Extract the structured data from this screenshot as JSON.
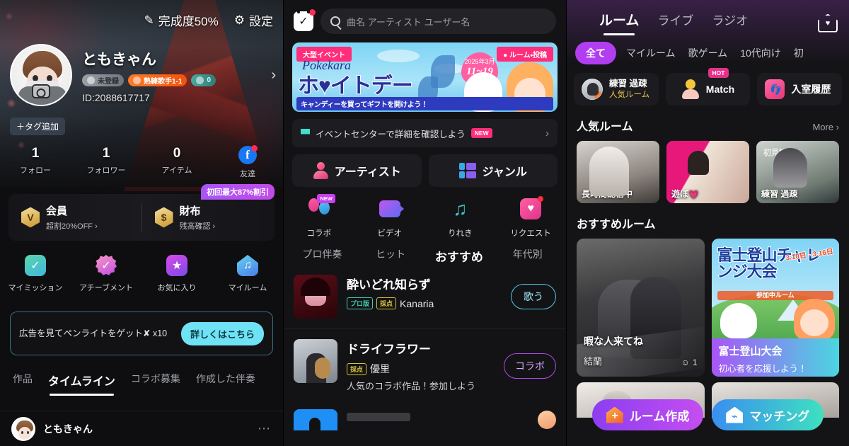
{
  "profile_panel": {
    "topbar": {
      "completion_label": "完成度50%",
      "completion_icon": "pencil-icon",
      "settings_label": "設定",
      "settings_icon": "gear-icon"
    },
    "user": {
      "name": "ともきゃん",
      "id_label": "ID:2088617717",
      "badges": [
        {
          "label": "未登録",
          "style": "gray"
        },
        {
          "label": "熟練歌手1-1",
          "style": "orange"
        },
        {
          "label": "0",
          "style": "teal"
        }
      ],
      "add_tag_label": "＋タグ追加",
      "chevron": "›"
    },
    "stats": [
      {
        "num": "1",
        "label": "フォロー"
      },
      {
        "num": "1",
        "label": "フォロワー"
      },
      {
        "num": "0",
        "label": "アイテム"
      },
      {
        "num": "f",
        "label": "友達"
      }
    ],
    "promo_badge": "初回最大87%割引",
    "cards": [
      {
        "icon": "V",
        "title": "会員",
        "sub": "超割20%OFF ›"
      },
      {
        "icon": "$",
        "title": "財布",
        "sub": "残高確認 ›"
      }
    ],
    "grid": [
      {
        "label": "マイミッション",
        "icon": "mission-icon"
      },
      {
        "label": "アチーブメント",
        "icon": "achievement-icon"
      },
      {
        "label": "お気に入り",
        "icon": "favorite-icon"
      },
      {
        "label": "マイルーム",
        "icon": "myroom-icon"
      }
    ],
    "ad": {
      "text": "広告を見てペンライトをゲット✘ x10",
      "button": "詳しくはこちら"
    },
    "tabs": [
      {
        "label": "作品",
        "active": false
      },
      {
        "label": "タイムライン",
        "active": true
      },
      {
        "label": "コラボ募集",
        "active": false
      },
      {
        "label": "作成した伴奏",
        "active": false
      }
    ],
    "feed": {
      "username": "ともきゃん",
      "more": "⋯"
    }
  },
  "discover_panel": {
    "search": {
      "placeholder": "曲名 アーティスト ユーザー名",
      "icon": "search-icon",
      "calendar_icon": "calendar-icon"
    },
    "banner": {
      "event_tag": "大型イベント",
      "corner_tag": "● ルーム・投稿",
      "script": "Pokekara",
      "title": "ホ♥イトデー",
      "subtitle": "キャンディーを買ってギフトを開けよう！",
      "date_small": "2025年3月",
      "date_range": "11~19"
    },
    "event_row": {
      "text": "イベントセンターで詳細を確認しよう",
      "badge": "NEW",
      "chevron": "›"
    },
    "duo_buttons": [
      {
        "label": "アーティスト",
        "icon": "artist-icon"
      },
      {
        "label": "ジャンル",
        "icon": "genre-icon"
      }
    ],
    "quick_icons": [
      {
        "label": "コラボ",
        "badge": "NEW",
        "icon": "balloon-icon"
      },
      {
        "label": "ビデオ",
        "badge": "",
        "icon": "video-icon"
      },
      {
        "label": "りれき",
        "badge": "",
        "icon": "music-note-icon"
      },
      {
        "label": "リクエスト",
        "badge": "dot",
        "icon": "heart-box-icon"
      }
    ],
    "subtabs": [
      {
        "label": "プロ伴奏",
        "active": false
      },
      {
        "label": "ヒット",
        "active": false
      },
      {
        "label": "おすすめ",
        "active": true
      },
      {
        "label": "年代別",
        "active": false
      }
    ],
    "songs": [
      {
        "title": "酔いどれ知らず",
        "tags": [
          "プロ版",
          "採点"
        ],
        "artist": "Kanaria",
        "sub": "",
        "action": "歌う",
        "action_style": "sing"
      },
      {
        "title": "ドライフラワー",
        "tags": [
          "採点"
        ],
        "artist": "優里",
        "sub": "人気のコラボ作品！参加しよう",
        "action": "コラボ",
        "action_style": "collab"
      }
    ]
  },
  "rooms_panel": {
    "nav": [
      {
        "label": "ルーム",
        "active": true
      },
      {
        "label": "ライブ",
        "active": false
      },
      {
        "label": "ラジオ",
        "active": false
      }
    ],
    "home_icon": "home-heart-icon",
    "chips": [
      {
        "label": "全て",
        "active": true
      },
      {
        "label": "マイルーム",
        "active": false
      },
      {
        "label": "歌ゲーム",
        "active": false
      },
      {
        "label": "10代向け",
        "active": false
      },
      {
        "label": "初",
        "active": false
      }
    ],
    "action_cards": [
      {
        "line1": "練習 過疎",
        "line2": "人気ルーム",
        "icon": "avatar-icon",
        "badge": ""
      },
      {
        "label": "Match",
        "icon": "match-icon",
        "badge": "HOT"
      },
      {
        "label": "入室履歴",
        "icon": "footprint-icon",
        "badge": ""
      }
    ],
    "popular_section": {
      "title": "人気ルーム",
      "more": "More ›"
    },
    "popular_rooms": [
      {
        "caption": "長時間配信中",
        "overlay": ""
      },
      {
        "caption": "遊ぼ💗",
        "overlay": ""
      },
      {
        "caption": "練習 過疎",
        "overlay": "初見歓迎"
      }
    ],
    "recommend_section": {
      "title": "おすすめルーム"
    },
    "recommend_rooms": [
      {
        "caption": "暇な人来てね",
        "user": "結蘭",
        "count": "1"
      },
      {
        "banner_title": "富士登山チャレンジ大会",
        "banner_dates": "3.10日 - 3.16日",
        "banner_strip": "参加中ルーム",
        "title": "富士登山大会",
        "sub": "初心者を応援しよう！"
      }
    ],
    "fab": [
      {
        "label": "ルーム作成",
        "icon": "create-room-icon"
      },
      {
        "label": "マッチング",
        "icon": "matching-icon"
      }
    ]
  }
}
